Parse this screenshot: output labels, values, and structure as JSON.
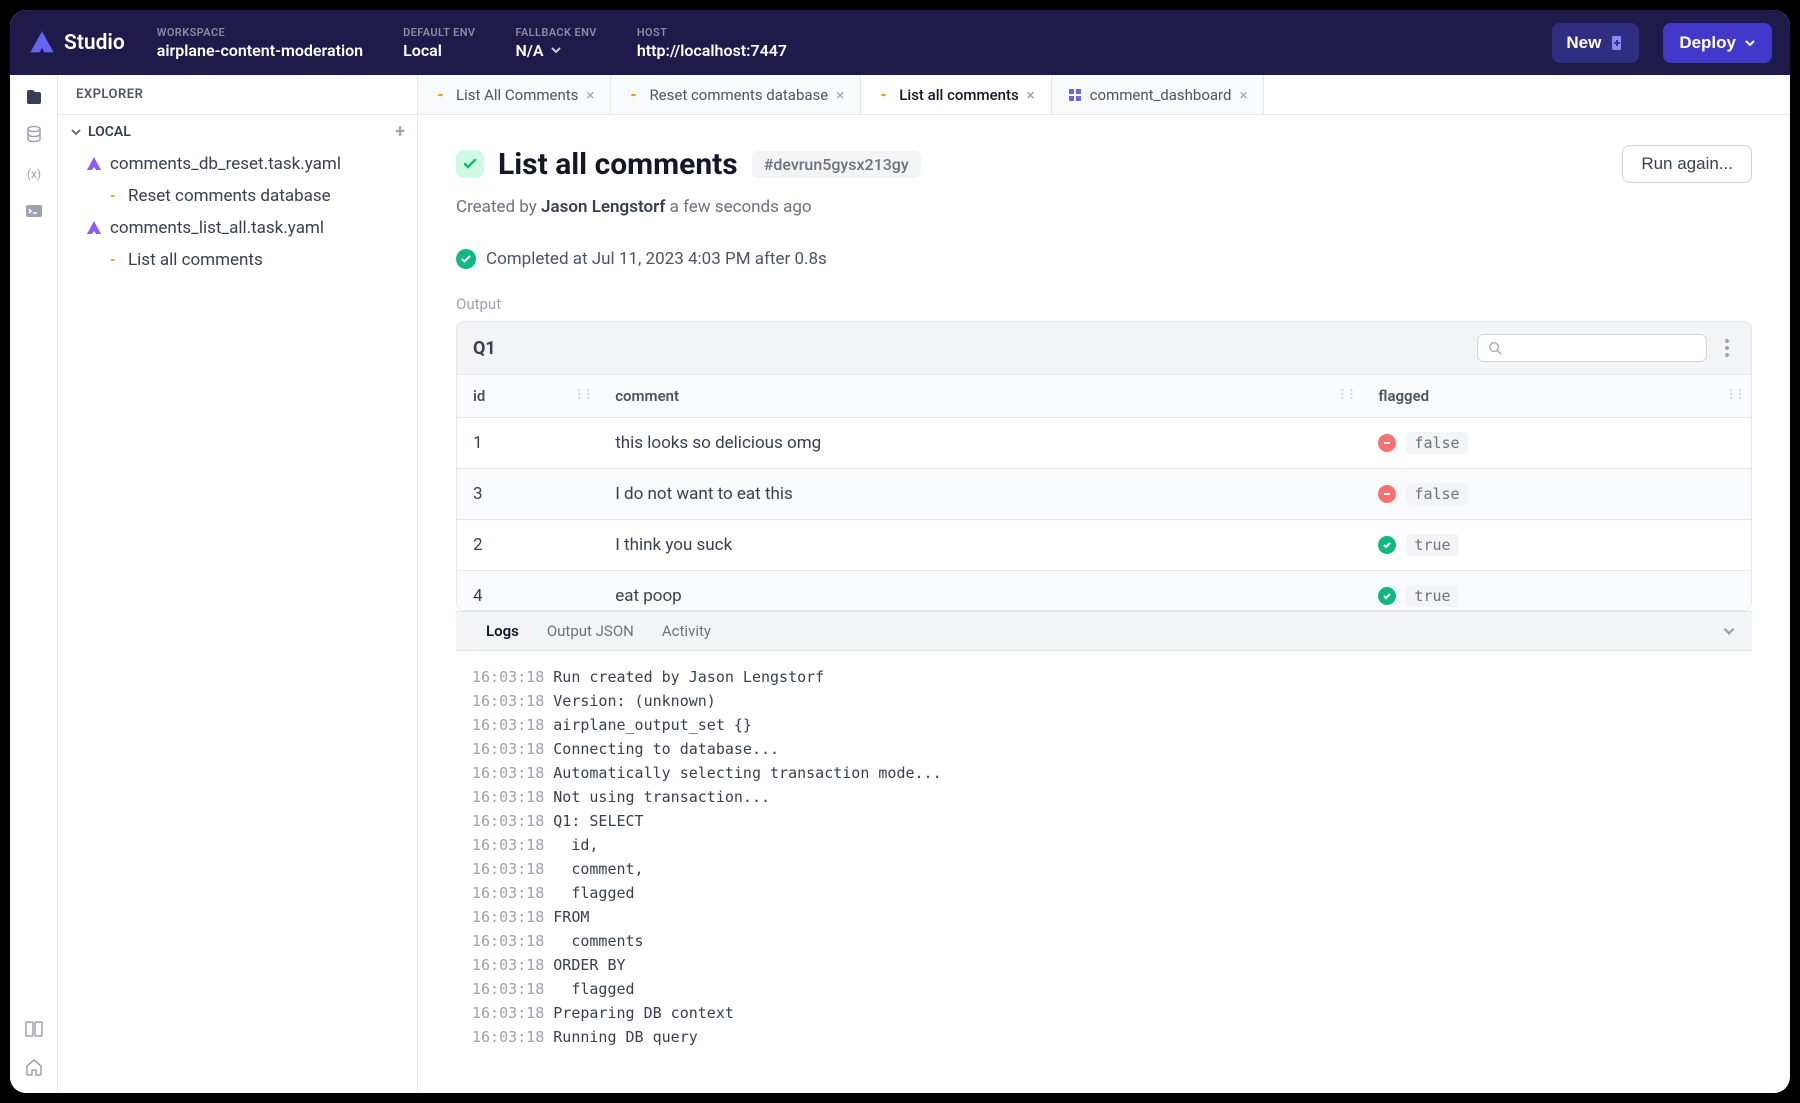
{
  "brand": "Studio",
  "header": {
    "workspace_label": "WORKSPACE",
    "workspace_value": "airplane-content-moderation",
    "default_env_label": "DEFAULT ENV",
    "default_env_value": "Local",
    "fallback_env_label": "FALLBACK ENV",
    "fallback_env_value": "N/A",
    "host_label": "HOST",
    "host_value": "http://localhost:7447",
    "new_button": "New",
    "deploy_button": "Deploy"
  },
  "explorer": {
    "title": "EXPLORER",
    "section": "LOCAL",
    "files": [
      {
        "name": "comments_db_reset.task.yaml",
        "children": [
          {
            "name": "Reset comments database"
          }
        ]
      },
      {
        "name": "comments_list_all.task.yaml",
        "children": [
          {
            "name": "List all comments"
          }
        ]
      }
    ]
  },
  "tabs": [
    {
      "label": "List All Comments",
      "type": "task",
      "active": false
    },
    {
      "label": "Reset comments database",
      "type": "task",
      "active": false
    },
    {
      "label": "List all comments",
      "type": "task",
      "active": true
    },
    {
      "label": "comment_dashboard",
      "type": "dash",
      "active": false
    }
  ],
  "run": {
    "title": "List all comments",
    "run_id": "#devrun5gysx213gy",
    "run_again": "Run again...",
    "created_by_prefix": "Created by ",
    "created_by_name": "Jason Lengstorf",
    "created_by_suffix": " a few seconds ago",
    "completed": "Completed at Jul 11, 2023 4:03 PM after 0.8s",
    "output_label": "Output"
  },
  "table": {
    "title": "Q1",
    "columns": [
      "id",
      "comment",
      "flagged"
    ],
    "rows": [
      {
        "id": "1",
        "comment": "this looks so delicious omg",
        "flagged": "false"
      },
      {
        "id": "3",
        "comment": "I do not want to eat this",
        "flagged": "false"
      },
      {
        "id": "2",
        "comment": "I think you suck",
        "flagged": "true"
      },
      {
        "id": "4",
        "comment": "eat poop",
        "flagged": "true"
      }
    ]
  },
  "panel": {
    "tabs": [
      "Logs",
      "Output JSON",
      "Activity"
    ],
    "active_tab": 0,
    "logs": [
      {
        "t": "16:03:18",
        "m": "Run created by Jason Lengstorf"
      },
      {
        "t": "16:03:18",
        "m": "Version: (unknown)"
      },
      {
        "t": "16:03:18",
        "m": "airplane_output_set {}"
      },
      {
        "t": "16:03:18",
        "m": "Connecting to database..."
      },
      {
        "t": "16:03:18",
        "m": "Automatically selecting transaction mode..."
      },
      {
        "t": "16:03:18",
        "m": "Not using transaction..."
      },
      {
        "t": "16:03:18",
        "m": "Q1: SELECT"
      },
      {
        "t": "16:03:18",
        "m": "  id,"
      },
      {
        "t": "16:03:18",
        "m": "  comment,"
      },
      {
        "t": "16:03:18",
        "m": "  flagged"
      },
      {
        "t": "16:03:18",
        "m": "FROM"
      },
      {
        "t": "16:03:18",
        "m": "  comments"
      },
      {
        "t": "16:03:18",
        "m": "ORDER BY"
      },
      {
        "t": "16:03:18",
        "m": "  flagged"
      },
      {
        "t": "16:03:18",
        "m": "Preparing DB context"
      },
      {
        "t": "16:03:18",
        "m": "Running DB query"
      }
    ]
  }
}
